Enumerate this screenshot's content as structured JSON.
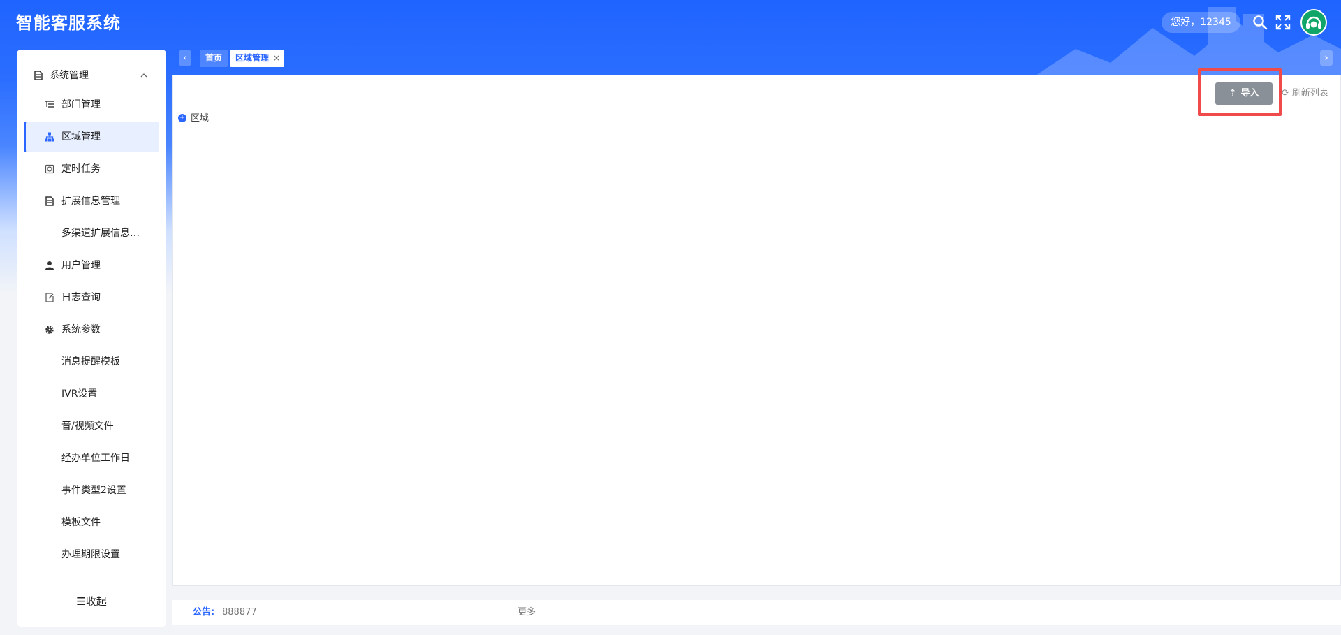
{
  "app": {
    "title": "智能客服系统",
    "greeting": "您好，12345"
  },
  "sidebar": {
    "items": [
      {
        "label": "系统管理",
        "icon": "doc-icon"
      },
      {
        "label": "部门管理",
        "icon": "list-tree-icon"
      },
      {
        "label": "区域管理",
        "icon": "org-chart-icon",
        "active": true
      },
      {
        "label": "定时任务",
        "icon": "timer-icon"
      },
      {
        "label": "扩展信息管理",
        "icon": "doc-icon"
      },
      {
        "label": "多渠道扩展信息…"
      },
      {
        "label": "用户管理",
        "icon": "user-icon"
      },
      {
        "label": "日志查询",
        "icon": "edit-doc-icon"
      },
      {
        "label": "系统参数",
        "icon": "gear-icon"
      },
      {
        "label": "消息提醒模板"
      },
      {
        "label": "IVR设置"
      },
      {
        "label": "音/视频文件"
      },
      {
        "label": "经办单位工作日"
      },
      {
        "label": "事件类型2设置"
      },
      {
        "label": "模板文件"
      },
      {
        "label": "办理期限设置"
      }
    ],
    "collapse_label": "☰收起"
  },
  "tabs": {
    "items": [
      {
        "label": "首页"
      },
      {
        "label": "区域管理",
        "active": true
      }
    ],
    "close_glyph": "×",
    "prev_glyph": "‹",
    "next_glyph": "›"
  },
  "main": {
    "import_label": "导入",
    "refresh_label": "刷新列表",
    "tree_root": "区域"
  },
  "notice": {
    "label": "公告:",
    "text": "888877",
    "more": "更多"
  },
  "colors": {
    "accent": "#2a66ff",
    "highlight": "#f04a4a"
  }
}
